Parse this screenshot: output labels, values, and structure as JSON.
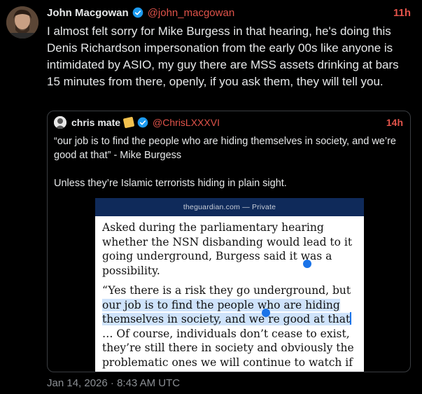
{
  "author": {
    "display_name": "John Macgowan",
    "handle": "@john_macgowan",
    "time": "11h"
  },
  "tweet": {
    "text": "I almost felt sorry for Mike Burgess in that hearing, he's doing this Denis Richardson impersonation from the early 00s like anyone is intimidated by ASIO, my guy there are MSS assets drinking at bars 15 minutes from there, openly, if you ask them, they will tell you."
  },
  "quote": {
    "display_name": "chris mate",
    "handle": "@ChrisLXXXVI",
    "time": "14h",
    "text_1": "“our job is to find the people who are hiding themselves in society, and we’re good at that” - Mike Burgess",
    "text_2": "Unless they’re Islamic terrorists hiding in plain sight.",
    "article": {
      "source": "theguardian.com — Private",
      "para_1": "Asked during the parliamentary hearing whether the NSN disbanding would lead to it going underground, Burgess said it was a possibility.",
      "para_2_before": "“Yes there is a risk they go underground, but ",
      "para_2_highlight": "our job is to find the people who are hiding themselves in society, and we’re good at that",
      "para_2_after": "… Of course, individuals don’t cease to exist, they’re still there in society and obviously the problematic ones we will continue to watch if they continue to be problematic,” Burgess said."
    }
  },
  "footer": {
    "timestamp": "Jan 14, 2026 · 8:43 AM UTC"
  },
  "colors": {
    "accent_time": "#e0534a",
    "verified": "#1d9bf0",
    "highlight": "#cfe3fb"
  }
}
